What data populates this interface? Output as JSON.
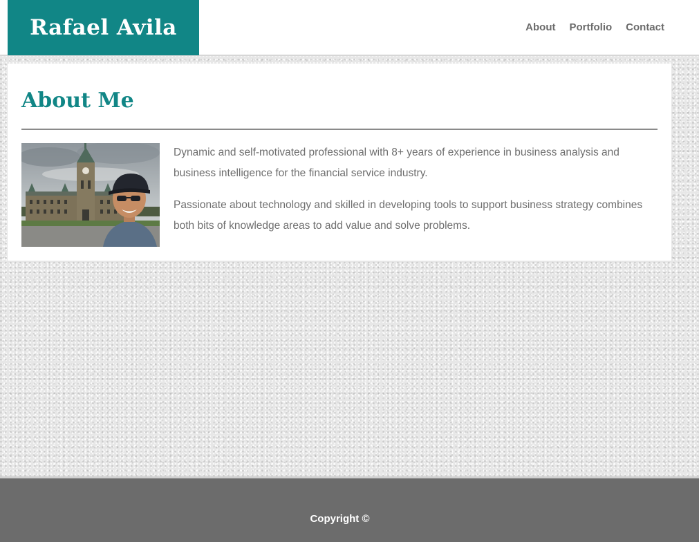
{
  "header": {
    "site_title": "Rafael Avila",
    "nav": {
      "about": "About",
      "portfolio": "Portfolio",
      "contact": "Contact"
    }
  },
  "about": {
    "heading": "About Me",
    "paragraphs": [
      "Dynamic and self-motivated professional with 8+ years of experience in business analysis and business intelligence for the financial service industry.",
      "Passionate about technology and skilled in developing tools to support business strategy combines both bits of knowledge areas to add value and solve problems."
    ]
  },
  "footer": {
    "copyright": "Copyright ©"
  },
  "colors": {
    "brand": "#118686",
    "footer": "#6c6c6c",
    "body_text": "#6e6e6e"
  }
}
